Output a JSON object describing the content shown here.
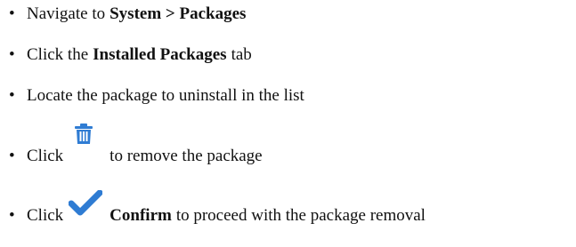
{
  "steps": [
    {
      "bullet": "•",
      "pre": "Navigate to",
      "bold": "System > Packages"
    },
    {
      "bullet": "•",
      "pre": "Click the",
      "bold": "Installed Packages",
      "post": "tab"
    },
    {
      "bullet": "•",
      "text": "Locate the package to uninstall in the list"
    },
    {
      "bullet": "•",
      "pre": "Click",
      "icon": "trash-icon",
      "post": "to remove the package"
    },
    {
      "bullet": "•",
      "pre": "Click",
      "icon": "checkmark-icon",
      "bold": "Confirm",
      "post": "to proceed with the package removal"
    }
  ],
  "colors": {
    "text": "#111111",
    "icon_blue": "#2f7cd3"
  }
}
